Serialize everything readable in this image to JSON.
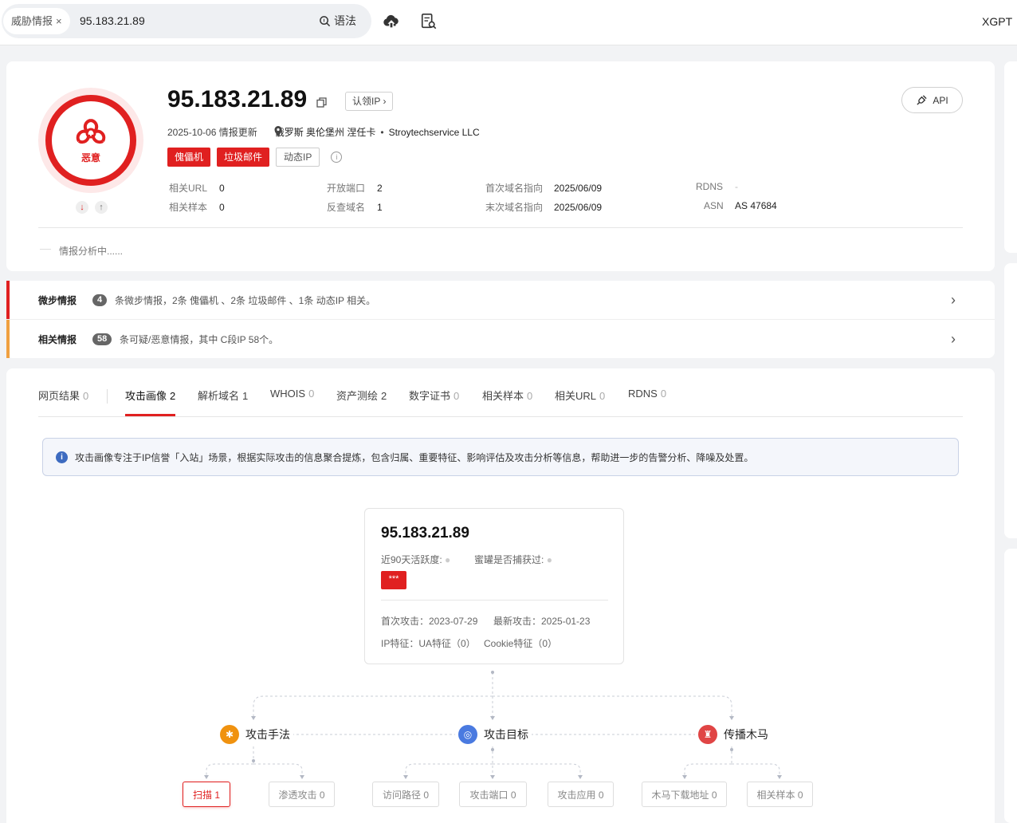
{
  "topbar": {
    "chip_label": "威胁情报",
    "chip_close": "×",
    "search_value": "95.183.21.89",
    "syntax_label": "语法",
    "brand": "XGPT"
  },
  "header": {
    "verdict": "恶意",
    "ip": "95.183.21.89",
    "claim_label": "认领IP",
    "claim_chevron": "›",
    "api_label": "API",
    "update_text": "2025-10-06 情报更新",
    "location": "俄罗斯 奥伦堡州 涅任卡",
    "separator": "•",
    "org": "Stroytechservice LLC",
    "tags": [
      "傀儡机",
      "垃圾邮件"
    ],
    "plain_tag": "动态IP",
    "info_glyph": "i",
    "vote_down": "↓",
    "vote_up": "↑",
    "stats": {
      "related_url_k": "相关URL",
      "related_url_v": "0",
      "related_sample_k": "相关样本",
      "related_sample_v": "0",
      "open_port_k": "开放端口",
      "open_port_v": "2",
      "reverse_domain_k": "反查域名",
      "reverse_domain_v": "1",
      "first_domain_k": "首次域名指向",
      "first_domain_v": "2025/06/09",
      "last_domain_k": "末次域名指向",
      "last_domain_v": "2025/06/09",
      "rdns_k": "RDNS",
      "rdns_v": "-",
      "asn_k": "ASN",
      "asn_v": "AS 47684"
    },
    "analysis": "情报分析中......"
  },
  "brief": {
    "micro_title": "微步情报",
    "micro_count": "4",
    "micro_desc": "条微步情报，2条 傀儡机 、2条 垃圾邮件 、1条 动态IP 相关。",
    "related_title": "相关情报",
    "related_count": "58",
    "related_desc": "条可疑/恶意情报，其中 C段IP 58个。",
    "chevron": "›"
  },
  "tabs": [
    {
      "label": "网页结果",
      "count": "0"
    },
    {
      "label": "攻击画像",
      "count": "2"
    },
    {
      "label": "解析域名",
      "count": "1"
    },
    {
      "label": "WHOIS",
      "count": "0"
    },
    {
      "label": "资产测绘",
      "count": "2"
    },
    {
      "label": "数字证书",
      "count": "0"
    },
    {
      "label": "相关样本",
      "count": "0"
    },
    {
      "label": "相关URL",
      "count": "0"
    },
    {
      "label": "RDNS",
      "count": "0"
    }
  ],
  "notice": {
    "icon": "i",
    "text": "攻击画像专注于IP信誉「入站」场景，根据实际攻击的信息聚合提炼，包含归属、重要特征、影响评估及攻击分析等信息，帮助进一步的告警分析、降噪及处置。"
  },
  "profile": {
    "ip": "95.183.21.89",
    "activity_label": "近90天活跃度:",
    "honeypot_label": "蜜罐是否捕获过:",
    "badge": "***",
    "first_attack": "首次攻击：2023-07-29",
    "last_attack": "最新攻击：2025-01-23",
    "ip_feature": "IP特征：UA特征（0）",
    "cookie_feature": "Cookie特征（0）"
  },
  "graph": {
    "nodes": [
      {
        "label": "攻击手法",
        "color": "#f0920f"
      },
      {
        "label": "攻击目标",
        "color": "#4a7ae0"
      },
      {
        "label": "传播木马",
        "color": "#e04545"
      }
    ],
    "leaves": [
      "扫描 1",
      "渗透攻击 0",
      "访问路径 0",
      "攻击端口 0",
      "攻击应用 0",
      "木马下载地址 0",
      "相关样本 0"
    ]
  }
}
